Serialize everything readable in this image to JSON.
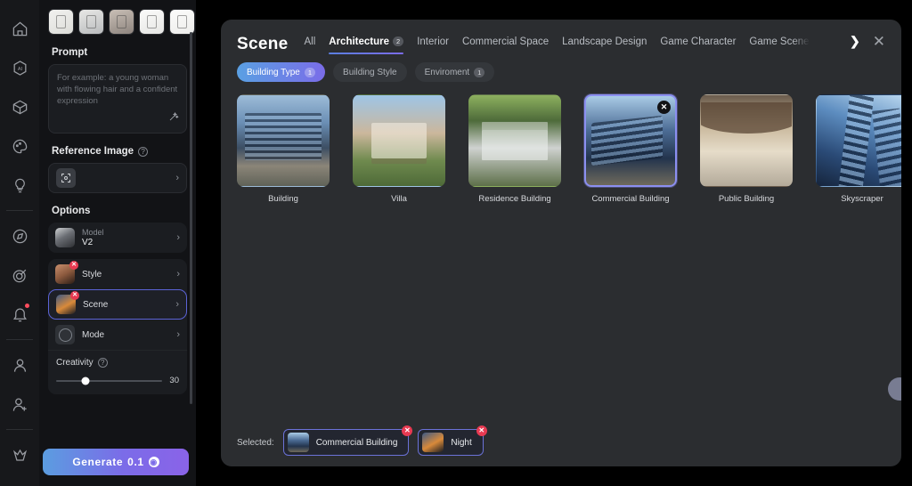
{
  "rail": {
    "items": [
      {
        "name": "home-icon",
        "label": "Home"
      },
      {
        "name": "ai-icon",
        "label": "AI"
      },
      {
        "name": "cube-icon",
        "label": "3D"
      },
      {
        "name": "palette-icon",
        "label": "Style"
      },
      {
        "name": "lightbulb-icon",
        "label": "Inspiration"
      },
      {
        "name": "compass-icon",
        "label": "Explore"
      },
      {
        "name": "target-icon",
        "label": "Goals"
      },
      {
        "name": "bell-icon",
        "label": "Notifications"
      },
      {
        "name": "user-icon",
        "label": "Profile"
      },
      {
        "name": "add-user-icon",
        "label": "Invite"
      },
      {
        "name": "crown-icon",
        "label": "Premium"
      }
    ]
  },
  "panel": {
    "thumbnails": [
      "sketch-thumb-1",
      "sketch-thumb-2",
      "sketch-thumb-3",
      "sketch-thumb-4",
      "sketch-thumb-5"
    ],
    "prompt": {
      "title": "Prompt",
      "placeholder": "For example: a young woman with flowing hair and a confident expression",
      "value": "",
      "magic_icon": "magic-wand-icon"
    },
    "reference": {
      "title": "Reference Image",
      "help": "?",
      "icon": "image-upload-icon",
      "chevron": "›"
    },
    "options": {
      "title": "Options",
      "rows": [
        {
          "key": "Model",
          "value": "V2",
          "chevron": "›",
          "removable": false,
          "selected": false
        },
        {
          "key": "Style",
          "value": "",
          "chevron": "›",
          "removable": true,
          "selected": false
        },
        {
          "key": "Scene",
          "value": "",
          "chevron": "›",
          "removable": true,
          "selected": true
        },
        {
          "key": "Mode",
          "value": "",
          "chevron": "›",
          "removable": false,
          "selected": false
        }
      ]
    },
    "creativity": {
      "label": "Creativity",
      "help": "?",
      "value": "30"
    },
    "generate": {
      "label": "Generate",
      "cost": "0.1",
      "coin": "◎"
    }
  },
  "modal": {
    "title": "Scene",
    "close": "✕",
    "scroll_next": "❯",
    "tabs": [
      {
        "label": "All",
        "count": "",
        "active": false
      },
      {
        "label": "Architecture",
        "count": "2",
        "active": true
      },
      {
        "label": "Interior",
        "count": "",
        "active": false
      },
      {
        "label": "Commercial Space",
        "count": "",
        "active": false
      },
      {
        "label": "Landscape Design",
        "count": "",
        "active": false
      },
      {
        "label": "Game Character",
        "count": "",
        "active": false
      },
      {
        "label": "Game Scene",
        "count": "",
        "active": false
      }
    ],
    "chips": [
      {
        "label": "Building Type",
        "count": "1",
        "active": true
      },
      {
        "label": "Building Style",
        "count": "",
        "active": false
      },
      {
        "label": "Enviroment",
        "count": "1",
        "active": false
      }
    ],
    "cards": [
      {
        "caption": "Building",
        "selected": false,
        "art": "bg1",
        "shape": "s1"
      },
      {
        "caption": "Villa",
        "selected": false,
        "art": "bg2",
        "shape": "s2"
      },
      {
        "caption": "Residence Building",
        "selected": false,
        "art": "bg3",
        "shape": "s3"
      },
      {
        "caption": "Commercial Building",
        "selected": true,
        "art": "bg4",
        "shape": "s4",
        "close": "✕"
      },
      {
        "caption": "Public Building",
        "selected": false,
        "art": "bg5",
        "shape": "s5"
      },
      {
        "caption": "Skyscraper",
        "selected": false,
        "art": "bg6",
        "shape": "s6"
      }
    ],
    "footer": {
      "selected_label": "Selected:",
      "chips": [
        {
          "label": "Commercial Building",
          "remove": "✕"
        },
        {
          "label": "Night",
          "remove": "✕"
        }
      ]
    }
  }
}
